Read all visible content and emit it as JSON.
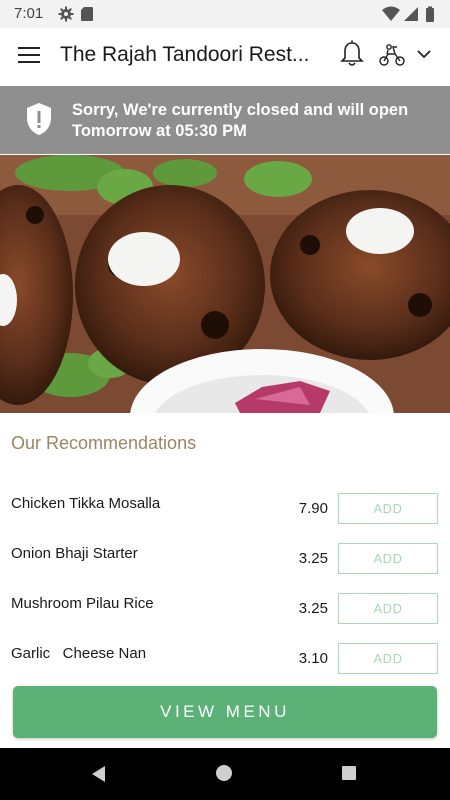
{
  "status_bar": {
    "time": "7:01",
    "icons": [
      "gear-icon",
      "sd-card-icon",
      "wifi-icon",
      "signal-icon",
      "battery-icon"
    ]
  },
  "app_bar": {
    "title": "The Rajah Tandoori Rest...",
    "icons": [
      "menu-icon",
      "bell-icon",
      "scooter-icon",
      "chevron-down-icon"
    ]
  },
  "closed_banner": {
    "message": "Sorry, We're currently closed and will open Tomorrow at 05:30 PM",
    "icon": "shield-alert-icon"
  },
  "recommendations": {
    "title": "Our Recommendations",
    "add_label": "ADD",
    "items": [
      {
        "name": "Chicken Tikka Mosalla",
        "price": "7.90"
      },
      {
        "name": "Onion Bhaji Starter",
        "price": "3.25"
      },
      {
        "name": "Mushroom Pilau Rice",
        "price": "3.25"
      },
      {
        "name": "Garlic   Cheese Nan",
        "price": "3.10"
      }
    ]
  },
  "view_menu_label": "VIEW MENU",
  "colors": {
    "accent_green": "#5bb176",
    "add_border": "#a8d8b4",
    "section_title": "#9b8563",
    "banner_bg": "#8f8f8f"
  }
}
